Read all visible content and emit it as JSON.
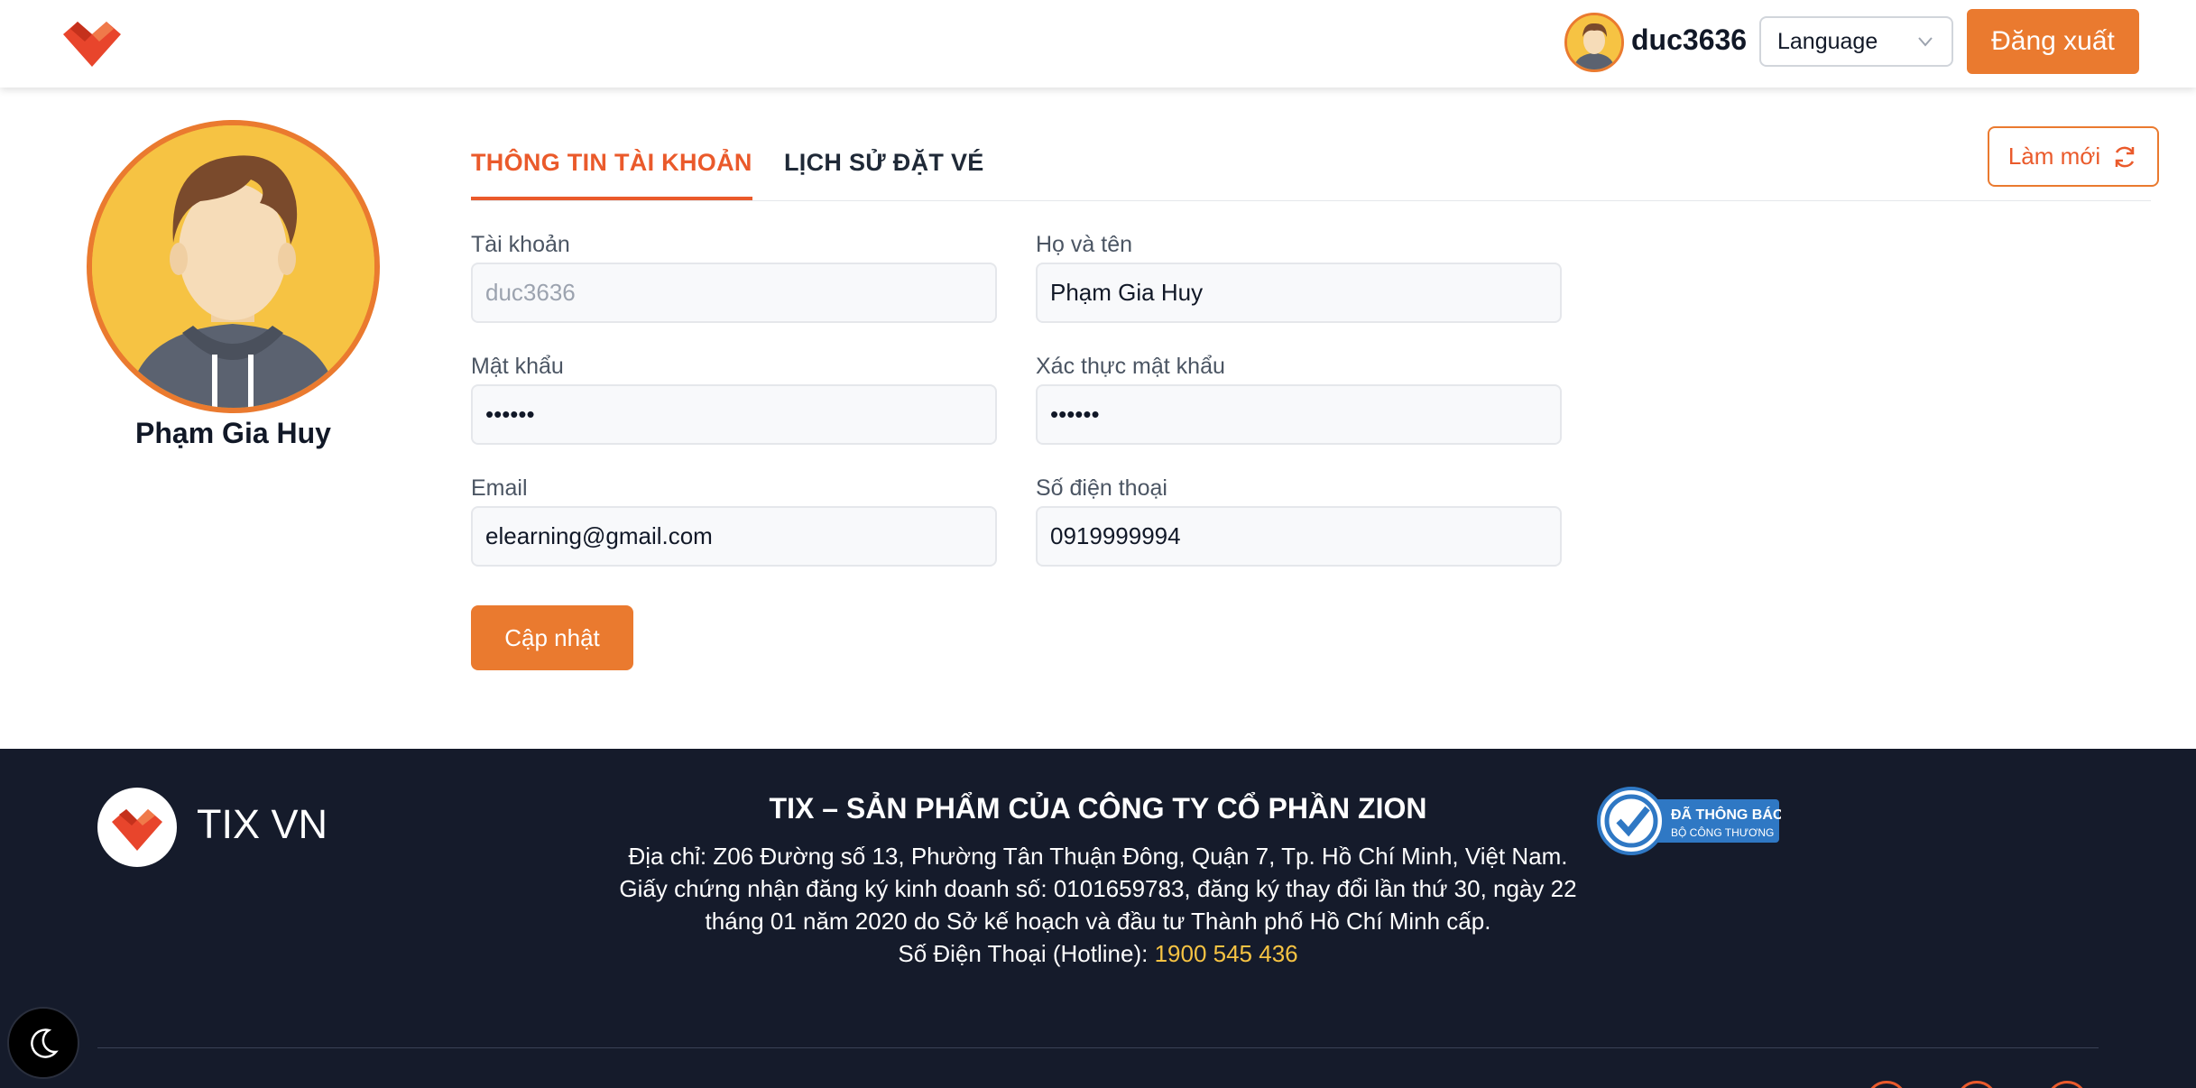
{
  "header": {
    "username": "duc3636",
    "language_label": "Language",
    "logout_label": "Đăng xuất"
  },
  "profile": {
    "name": "Phạm Gia Huy"
  },
  "tabs": [
    {
      "label": "THÔNG TIN TÀI KHOẢN",
      "active": true
    },
    {
      "label": "LỊCH SỬ ĐẶT VÉ",
      "active": false
    }
  ],
  "refresh_label": "Làm mới",
  "form": {
    "account_label": "Tài khoản",
    "account_value": "duc3636",
    "fullname_label": "Họ và tên",
    "fullname_value": "Phạm Gia Huy",
    "password_label": "Mật khẩu",
    "password_value": "••••••",
    "confirm_label": "Xác thực mật khẩu",
    "confirm_value": "••••••",
    "email_label": "Email",
    "email_value": "elearning@gmail.com",
    "phone_label": "Số điện thoại",
    "phone_value": "0919999994",
    "update_label": "Cập nhật"
  },
  "footer": {
    "brand": "TIX VN",
    "title": "TIX – SẢN PHẨM CỦA CÔNG TY CỔ PHẦN ZION",
    "address": "Địa chỉ: Z06 Đường số 13, Phường Tân Thuận Đông, Quận 7, Tp. Hồ Chí Minh, Việt Nam.",
    "license_line1": "Giấy chứng nhận đăng ký kinh doanh số: 0101659783, đăng ký thay đổi lần thứ 30, ngày 22",
    "license_line2": "tháng 01 năm 2020 do Sở kế hoạch và đầu tư Thành phố Hồ Chí Minh cấp.",
    "hotline_label": "Số Điện Thoại (Hotline): ",
    "hotline_number": "1900 545 436",
    "badge_line1": "ĐÃ THÔNG BÁO",
    "badge_line2": "BỘ CÔNG THƯƠNG"
  },
  "colors": {
    "accent": "#ea7a2f",
    "accent_text": "#ea5a2b",
    "footer_bg": "#151b2b",
    "hotline": "#f6c343"
  },
  "icons": [
    "logo-icon",
    "chevron-down-icon",
    "refresh-icon",
    "moon-icon",
    "check-badge-icon"
  ]
}
